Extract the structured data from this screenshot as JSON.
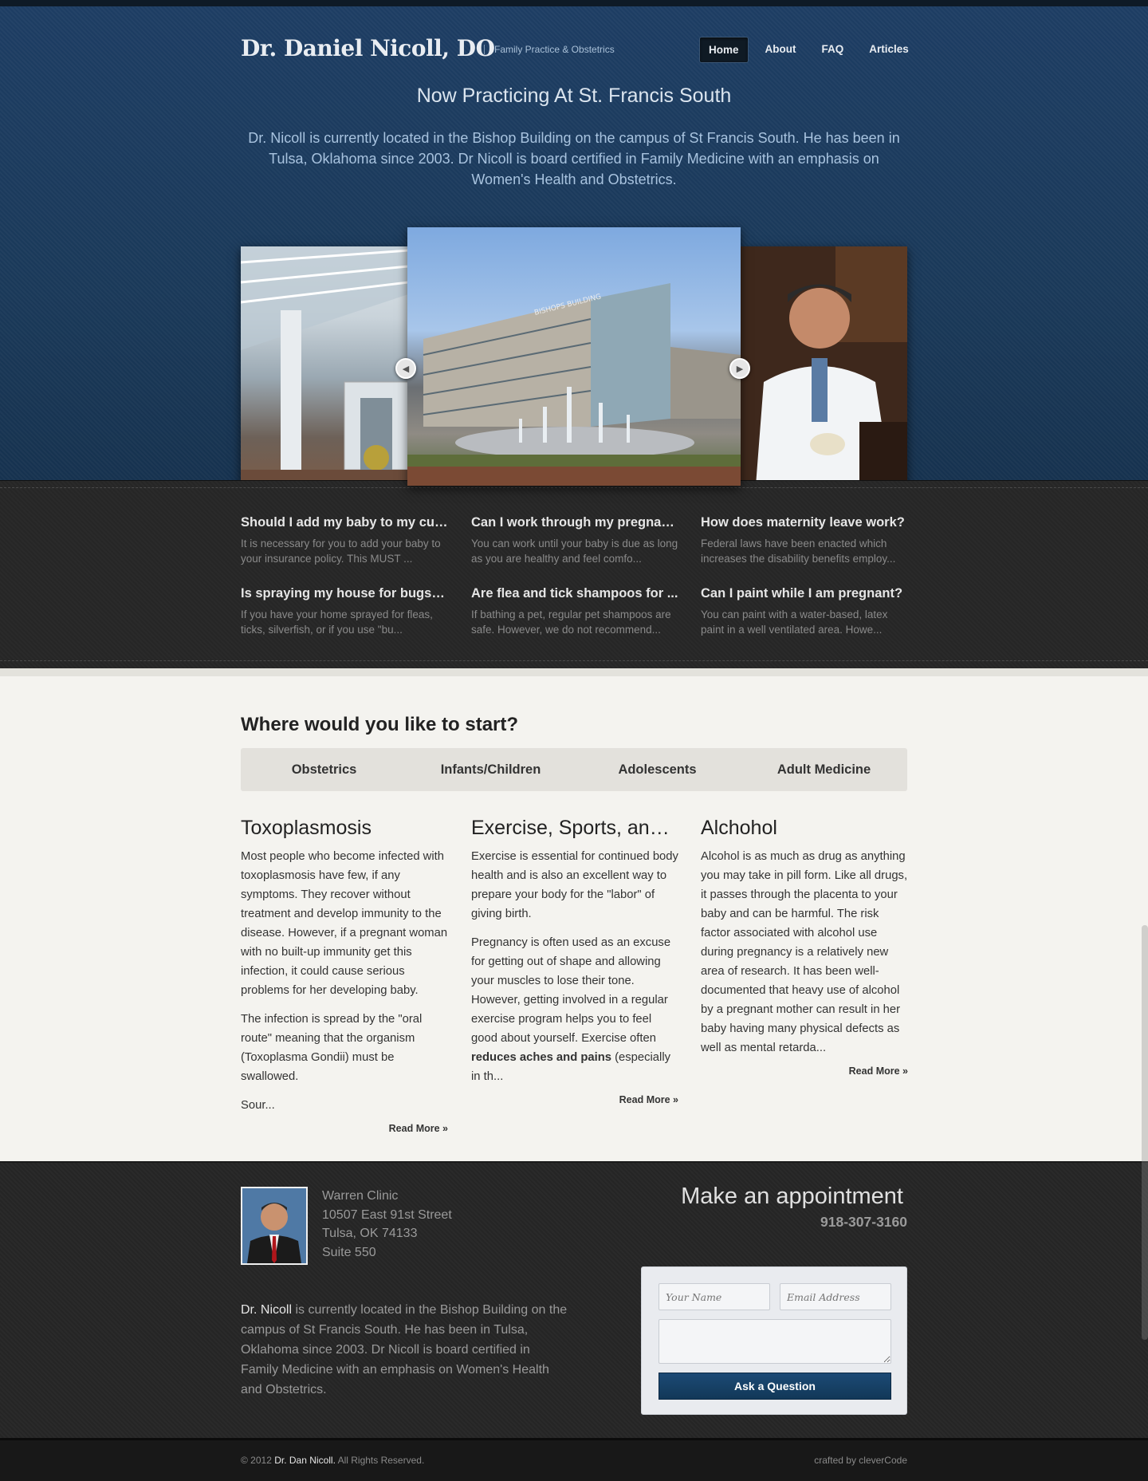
{
  "header": {
    "logo": "Dr. Daniel Nicoll, DO",
    "tagline": "Family Practice & Obstetrics",
    "nav": [
      {
        "label": "Home",
        "active": true
      },
      {
        "label": "About"
      },
      {
        "label": "FAQ"
      },
      {
        "label": "Articles"
      }
    ]
  },
  "hero": {
    "title": "Now Practicing At St. Francis South",
    "text": "Dr. Nicoll is currently located in the Bishop Building on the campus of St Francis South. He has been in Tulsa, Oklahoma since 2003. Dr Nicoll is board certified in Family Medicine with an emphasis on Women's Health and Obstetrics.",
    "building_sign": "BISHOPS BUILDING"
  },
  "faq": [
    {
      "q": "Should I add my baby to my cur...",
      "a": "It is necessary for you to add your baby to your insurance policy. This MUST ..."
    },
    {
      "q": "Can I work through my pregnan...",
      "a": "You can work until your baby is due as long as you are healthy and feel comfo..."
    },
    {
      "q": "How does maternity leave work?",
      "a": "Federal laws have been enacted which increases the disability benefits employ..."
    },
    {
      "q": "Is spraying my house for bugs a ...",
      "a": "If you have your home sprayed for fleas, ticks, silverfish, or if you use \"bu..."
    },
    {
      "q": "Are flea and tick shampoos for ...",
      "a": "If bathing a pet, regular pet shampoos are safe. However, we do not recommend..."
    },
    {
      "q": "Can I paint while I am pregnant?",
      "a": "You can paint with a water-based, latex paint in a well ventilated area. Howe..."
    }
  ],
  "main": {
    "start_title": "Where would you like to start?",
    "tabs": [
      "Obstetrics",
      "Infants/Children",
      "Adolescents",
      "Adult Medicine"
    ],
    "articles": [
      {
        "title": "Toxoplasmosis",
        "p1": "Most people who become infected with toxoplasmosis have few, if any symptoms. They recover without treatment and develop immunity to the disease. However, if a pregnant woman with no built-up immunity get this infection, it could cause serious problems for her developing baby.",
        "p2": "The infection is spread by the \"oral route\" meaning that the organism (Toxoplasma Gondii) must be swallowed.",
        "p3": "Sour...",
        "read_more": "Read More »"
      },
      {
        "title": "Exercise, Sports, and ...",
        "p1": "Exercise is essential for continued body health and is also an excellent way to prepare your body for the \"labor\" of giving birth.",
        "p2_before": "Pregnancy is often used as an excuse for getting out of shape and allowing your muscles to lose their tone. However, getting involved in a regular exercise program helps you to feel good about yourself. Exercise often ",
        "p2_bold": "reduces aches and pains",
        "p2_after": " (especially in th...",
        "read_more": "Read More »"
      },
      {
        "title": "Alchohol",
        "p1": "Alcohol is as much as drug as anything you may take in pill form. Like all drugs, it passes through the placenta to your baby and can be harmful. The risk factor associated with alcohol use during pregnancy is a relatively new area of research. It has been well-documented that heavy use of alcohol by a pregnant mother can result in her baby having many physical defects as well as mental retarda...",
        "read_more": "Read More »"
      }
    ]
  },
  "footer": {
    "address": [
      "Warren Clinic",
      "10507 East 91st Street",
      "Tulsa, OK 74133",
      "Suite 550"
    ],
    "about_name": "Dr. Nicoll",
    "about_text": " is currently located in the Bishop Building on the campus of St Francis South. He has been in Tulsa, Oklahoma since 2003. Dr Nicoll is board certified in Family Medicine with an emphasis on Women's Health and Obstetrics.",
    "appointment_title": "Make an appointment",
    "phone": "918-307-3160",
    "form": {
      "name_placeholder": "Your Name",
      "email_placeholder": "Email Address",
      "submit_label": "Ask a Question"
    },
    "copyright_prefix": "© 2012 ",
    "copyright_owner": "Dr. Dan Nicoll.",
    "copyright_suffix": " All Rights Reserved.",
    "credit": "crafted by cleverCode"
  },
  "colors": {
    "hero_blue": "#1a3959",
    "button_blue": "#123858",
    "cream": "#f4f3ef"
  }
}
